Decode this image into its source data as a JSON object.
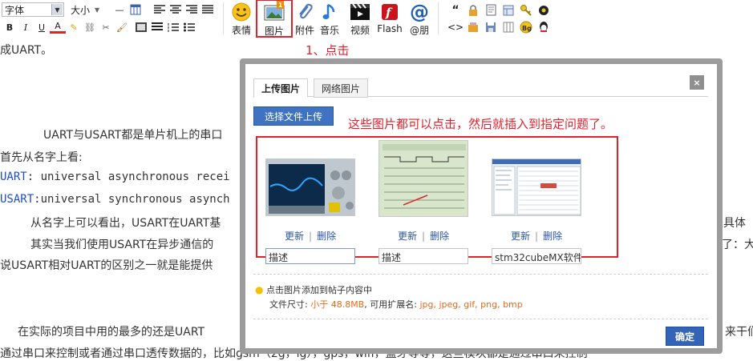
{
  "toolbar": {
    "font_select": "字体",
    "size_select": "大小",
    "format_buttons": [
      "B",
      "I",
      "U",
      "A"
    ],
    "big_buttons": [
      {
        "icon": "smiley-icon",
        "label": "表情"
      },
      {
        "icon": "image-icon",
        "label": "图片"
      },
      {
        "icon": "paperclip-icon",
        "label": "附件"
      },
      {
        "icon": "music-note-icon",
        "label": "音乐"
      },
      {
        "icon": "video-icon",
        "label": "视频"
      },
      {
        "icon": "flash-icon",
        "label": "Flash"
      },
      {
        "icon": "at-icon",
        "label": "@朋"
      }
    ],
    "image_button_badge": "1"
  },
  "document": {
    "line_top": "成UART。",
    "para1": "UART与USART都是单片机上的串口",
    "para1b": "首先从名字上看:",
    "uart_label": "UART",
    "uart_text": ": universal asynchronous recei",
    "usart_label": "USART",
    "usart_text": ":universal synchronous asynch",
    "para2": "从名字上可以看出，USART在UART基",
    "para2_right": "是具体",
    "para3": "其实当我们使用USART在异步通信的",
    "para3_right": "了：大",
    "para4": "说USART相对UART的区别之一就是能提供",
    "para5": "在实际的项目中用的最多的还是UART",
    "para5_right": "来干们",
    "para6": "通过串口来控制或者通过串口透传数据的，比如gsm（2g，lg），gps，wifi，蓝牙等等，这些模块都是通过串口来控制"
  },
  "annotations": {
    "step1": "1、点击",
    "step2": "这些图片都可以点击，然后就插入到指定问题了。"
  },
  "dialog": {
    "tabs": [
      "上传图片",
      "网络图片"
    ],
    "active_tab": 0,
    "close_label": "×",
    "upload_button": "选择文件上传",
    "images": [
      {
        "update": "更新",
        "delete": "删除",
        "description": "描述"
      },
      {
        "update": "更新",
        "delete": "删除",
        "description": "描述"
      },
      {
        "update": "更新",
        "delete": "删除",
        "description": "stm32cubeMX软件"
      }
    ],
    "hint_line1": "点击图片添加到帖子内容中",
    "hint_size_label": "文件尺寸: ",
    "hint_size_value": "小于 48.8MB",
    "hint_ext_label": ", 可用扩展名: ",
    "hint_ext_value": "jpg, jpeg, gif, png, bmp",
    "ok_button": "确定"
  },
  "colors": {
    "annotation_red": "#e0222d",
    "link_blue": "#2a55a6",
    "button_blue": "#3f72c0",
    "hint_orange": "#e46b1f"
  }
}
